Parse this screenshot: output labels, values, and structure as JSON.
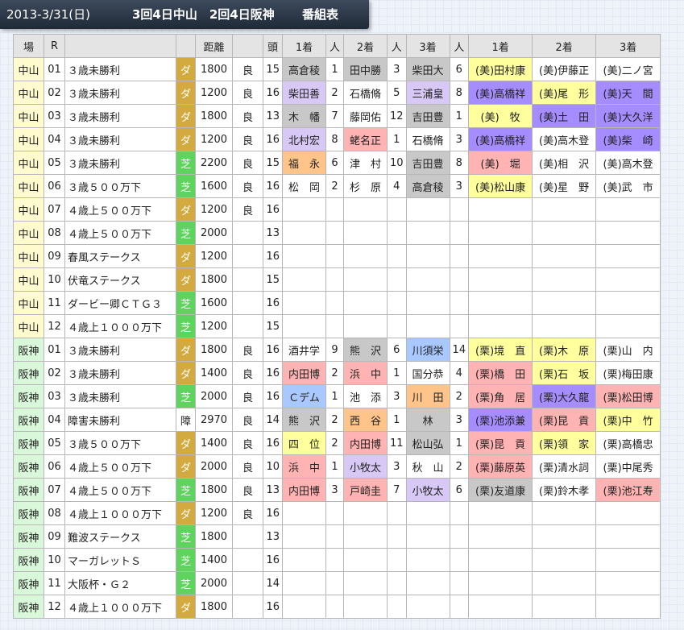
{
  "header": {
    "date": "2013-3/31(日)",
    "venues": "3回4日中山　2回4日阪神",
    "program": "番組表"
  },
  "columns": [
    "場",
    "R",
    "",
    "",
    "距離",
    "",
    "頭",
    "1着",
    "人",
    "2着",
    "人",
    "3着",
    "人",
    "1着",
    "2着",
    "3着"
  ],
  "rows": [
    {
      "venue": "中山",
      "r": "01",
      "name": "３歳未勝利",
      "surface": "ダ",
      "dist": "1800",
      "cond": "良",
      "heads": "15",
      "w1": "高倉稜",
      "p1": "1",
      "w2": "田中勝",
      "p2": "3",
      "w3": "柴田大",
      "p3": "6",
      "t1": "(美)田村康",
      "t2": "(美)伊藤正",
      "t3": "(美)二ノ宮",
      "c1": "gray",
      "c2": "gray",
      "c3": "gray",
      "ct1": "yellow",
      "ct2": "none",
      "ct3": "none"
    },
    {
      "venue": "中山",
      "r": "02",
      "name": "３歳未勝利",
      "surface": "ダ",
      "dist": "1200",
      "cond": "良",
      "heads": "16",
      "w1": "柴田善",
      "p1": "2",
      "w2": "石橋脩",
      "p2": "5",
      "w3": "三浦皇",
      "p3": "8",
      "t1": "(美)高橋祥",
      "t2": "(美)尾　形",
      "t3": "(美)天　間",
      "c1": "lav",
      "c2": "none",
      "c3": "lav",
      "ct1": "purple",
      "ct2": "yellow",
      "ct3": "purple"
    },
    {
      "venue": "中山",
      "r": "03",
      "name": "３歳未勝利",
      "surface": "ダ",
      "dist": "1800",
      "cond": "良",
      "heads": "13",
      "w1": "木　幡",
      "p1": "7",
      "w2": "藤岡佑",
      "p2": "12",
      "w3": "吉田豊",
      "p3": "1",
      "t1": "(美)　牧",
      "t2": "(美)土　田",
      "t3": "(美)大久洋",
      "c1": "gray",
      "c2": "none",
      "c3": "gray",
      "ct1": "yellow",
      "ct2": "purple",
      "ct3": "purple"
    },
    {
      "venue": "中山",
      "r": "04",
      "name": "３歳未勝利",
      "surface": "ダ",
      "dist": "1200",
      "cond": "良",
      "heads": "16",
      "w1": "北村宏",
      "p1": "8",
      "w2": "蛯名正",
      "p2": "1",
      "w3": "石橋脩",
      "p3": "3",
      "t1": "(美)高橋祥",
      "t2": "(美)高木登",
      "t3": "(美)柴　崎",
      "c1": "lav",
      "c2": "pink",
      "c3": "none",
      "ct1": "purple",
      "ct2": "none",
      "ct3": "purple"
    },
    {
      "venue": "中山",
      "r": "05",
      "name": "３歳未勝利",
      "surface": "芝",
      "dist": "2200",
      "cond": "良",
      "heads": "15",
      "w1": "福　永",
      "p1": "6",
      "w2": "津　村",
      "p2": "10",
      "w3": "吉田豊",
      "p3": "8",
      "t1": "(美)　堀",
      "t2": "(美)相　沢",
      "t3": "(美)高木登",
      "c1": "peach",
      "c2": "none",
      "c3": "gray",
      "ct1": "pink",
      "ct2": "none",
      "ct3": "none"
    },
    {
      "venue": "中山",
      "r": "06",
      "name": "３歳５００万下",
      "surface": "芝",
      "dist": "1600",
      "cond": "良",
      "heads": "16",
      "w1": "松　岡",
      "p1": "2",
      "w2": "杉　原",
      "p2": "4",
      "w3": "高倉稜",
      "p3": "3",
      "t1": "(美)松山康",
      "t2": "(美)星　野",
      "t3": "(美)武　市",
      "c1": "none",
      "c2": "none",
      "c3": "gray",
      "ct1": "yellow",
      "ct2": "none",
      "ct3": "none"
    },
    {
      "venue": "中山",
      "r": "07",
      "name": "４歳上５００万下",
      "surface": "ダ",
      "dist": "1200",
      "cond": "良",
      "heads": "16"
    },
    {
      "venue": "中山",
      "r": "08",
      "name": "４歳上５００万下",
      "surface": "芝",
      "dist": "2000",
      "cond": "",
      "heads": "13"
    },
    {
      "venue": "中山",
      "r": "09",
      "name": "春風ステークス",
      "surface": "ダ",
      "dist": "1200",
      "cond": "",
      "heads": "16"
    },
    {
      "venue": "中山",
      "r": "10",
      "name": "伏竜ステークス",
      "surface": "ダ",
      "dist": "1800",
      "cond": "",
      "heads": "15"
    },
    {
      "venue": "中山",
      "r": "11",
      "name": "ダービー卿ＣＴＧ３",
      "surface": "芝",
      "dist": "1600",
      "cond": "",
      "heads": "16"
    },
    {
      "venue": "中山",
      "r": "12",
      "name": "４歳上１０００万下",
      "surface": "芝",
      "dist": "1200",
      "cond": "",
      "heads": "15"
    },
    {
      "venue": "阪神",
      "r": "01",
      "name": "３歳未勝利",
      "surface": "ダ",
      "dist": "1800",
      "cond": "良",
      "heads": "16",
      "w1": "酒井学",
      "p1": "9",
      "w2": "熊　沢",
      "p2": "6",
      "w3": "川須栄",
      "p3": "14",
      "t1": "(栗)境　直",
      "t2": "(栗)木　原",
      "t3": "(栗)山　内",
      "c1": "none",
      "c2": "gray",
      "c3": "blue",
      "ct1": "yellow",
      "ct2": "yellow",
      "ct3": "none"
    },
    {
      "venue": "阪神",
      "r": "02",
      "name": "３歳未勝利",
      "surface": "ダ",
      "dist": "1400",
      "cond": "良",
      "heads": "16",
      "w1": "内田博",
      "p1": "2",
      "w2": "浜　中",
      "p2": "1",
      "w3": "国分恭",
      "p3": "4",
      "t1": "(栗)橋　田",
      "t2": "(栗)石　坂",
      "t3": "(栗)梅田康",
      "c1": "pink",
      "c2": "pink",
      "c3": "none",
      "ct1": "pink",
      "ct2": "yellow",
      "ct3": "none"
    },
    {
      "venue": "阪神",
      "r": "03",
      "name": "３歳未勝利",
      "surface": "芝",
      "dist": "2000",
      "cond": "良",
      "heads": "16",
      "w1": "Ｃデム",
      "p1": "1",
      "w2": "池　添",
      "p2": "3",
      "w3": "川　田",
      "p3": "2",
      "t1": "(栗)角　居",
      "t2": "(栗)大久龍",
      "t3": "(栗)松田博",
      "c1": "blue",
      "c2": "none",
      "c3": "peach",
      "ct1": "pink",
      "ct2": "purple",
      "ct3": "pink"
    },
    {
      "venue": "阪神",
      "r": "04",
      "name": "障害未勝利",
      "surface": "障",
      "dist": "2970",
      "cond": "良",
      "heads": "14",
      "w1": "熊　沢",
      "p1": "2",
      "w2": "西　谷",
      "p2": "1",
      "w3": "林",
      "p3": "3",
      "t1": "(栗)池添兼",
      "t2": "(栗)昆　貢",
      "t3": "(栗)中　竹",
      "c1": "gray",
      "c2": "peach",
      "c3": "gray",
      "ct1": "purple",
      "ct2": "pink",
      "ct3": "yellow"
    },
    {
      "venue": "阪神",
      "r": "05",
      "name": "３歳５００万下",
      "surface": "ダ",
      "dist": "1400",
      "cond": "良",
      "heads": "16",
      "w1": "四　位",
      "p1": "2",
      "w2": "内田博",
      "p2": "11",
      "w3": "松山弘",
      "p3": "1",
      "t1": "(栗)昆　貢",
      "t2": "(栗)領　家",
      "t3": "(栗)高橋忠",
      "c1": "yellow",
      "c2": "pink",
      "c3": "gray",
      "ct1": "pink",
      "ct2": "yellow",
      "ct3": "none"
    },
    {
      "venue": "阪神",
      "r": "06",
      "name": "４歳上５００万下",
      "surface": "ダ",
      "dist": "2000",
      "cond": "良",
      "heads": "10",
      "w1": "浜　中",
      "p1": "1",
      "w2": "小牧太",
      "p2": "3",
      "w3": "秋　山",
      "p3": "2",
      "t1": "(栗)藤原英",
      "t2": "(栗)清水詞",
      "t3": "(栗)中尾秀",
      "c1": "pink",
      "c2": "lav",
      "c3": "none",
      "ct1": "pink",
      "ct2": "none",
      "ct3": "none"
    },
    {
      "venue": "阪神",
      "r": "07",
      "name": "４歳上５００万下",
      "surface": "芝",
      "dist": "1800",
      "cond": "良",
      "heads": "13",
      "w1": "内田博",
      "p1": "3",
      "w2": "戸崎圭",
      "p2": "7",
      "w3": "小牧太",
      "p3": "6",
      "t1": "(栗)友道康",
      "t2": "(栗)鈴木孝",
      "t3": "(栗)池江寿",
      "c1": "pink",
      "c2": "pink",
      "c3": "lav",
      "ct1": "gray",
      "ct2": "none",
      "ct3": "pink"
    },
    {
      "venue": "阪神",
      "r": "08",
      "name": "４歳上１０００万下",
      "surface": "ダ",
      "dist": "1200",
      "cond": "良",
      "heads": "16"
    },
    {
      "venue": "阪神",
      "r": "09",
      "name": "難波ステークス",
      "surface": "芝",
      "dist": "1800",
      "cond": "",
      "heads": "13"
    },
    {
      "venue": "阪神",
      "r": "10",
      "name": "マーガレットＳ",
      "surface": "芝",
      "dist": "1400",
      "cond": "",
      "heads": "16"
    },
    {
      "venue": "阪神",
      "r": "11",
      "name": "大阪杯・Ｇ２",
      "surface": "芝",
      "dist": "2000",
      "cond": "",
      "heads": "14"
    },
    {
      "venue": "阪神",
      "r": "12",
      "name": "４歳上１０００万下",
      "surface": "ダ",
      "dist": "1800",
      "cond": "",
      "heads": "16"
    }
  ]
}
